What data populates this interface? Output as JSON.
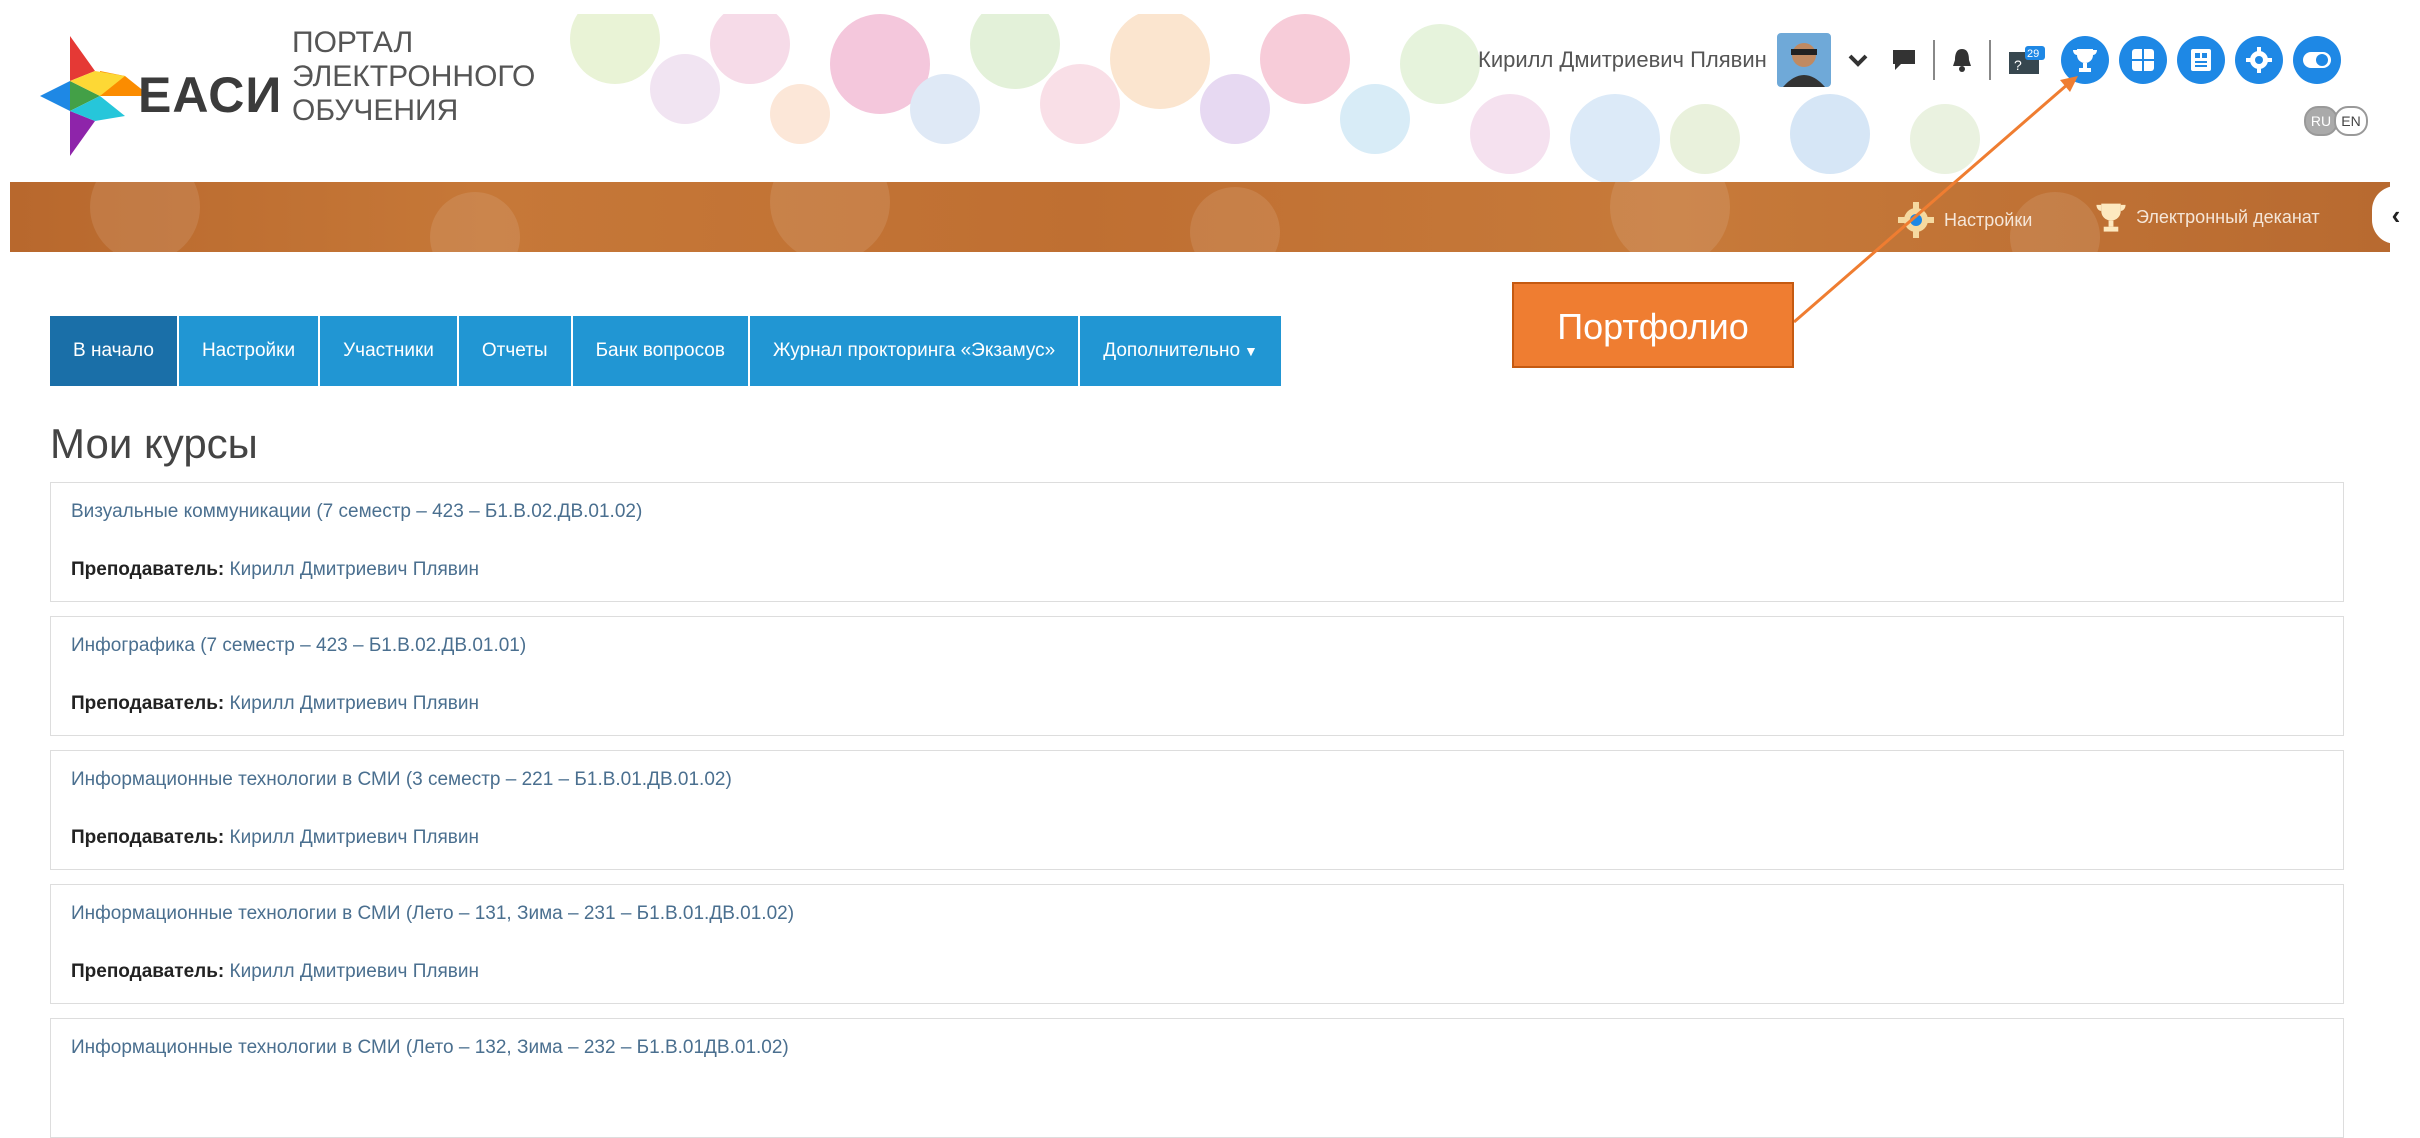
{
  "header": {
    "brand": "ЕАСИ",
    "portal_title": [
      "ПОРТАЛ",
      "ЭЛЕКТРОННОГО",
      "ОБУЧЕНИЯ"
    ],
    "user_name": "Кирилл Дмитриевич Плявин",
    "message_badge": "29",
    "languages": [
      "RU",
      "EN"
    ],
    "active_language": "RU",
    "round_icons": [
      "trophy-icon",
      "grid-icon",
      "report-icon",
      "gear-icon",
      "toggle-icon"
    ],
    "accent_color": "#1e88e5"
  },
  "band": {
    "settings_label": "Настройки",
    "deanery_label": "Электронный деканат",
    "color": "#c27436"
  },
  "nav": {
    "items": [
      "В начало",
      "Настройки",
      "Участники",
      "Отчеты",
      "Банк вопросов",
      "Журнал прокторинга «Экзамус»",
      "Дополнительно"
    ],
    "active_index": 0,
    "color": "#2196d3"
  },
  "annotation": {
    "label": "Портфолио",
    "color": "#ef7d31"
  },
  "main": {
    "title": "Мои курсы",
    "teacher_label": "Преподаватель:",
    "courses": [
      {
        "name": "Визуальные коммуникации (7 семестр – 423 – Б1.В.02.ДВ.01.02)",
        "teacher": "Кирилл Дмитриевич Плявин"
      },
      {
        "name": "Инфографика (7 семестр – 423 – Б1.В.02.ДВ.01.01)",
        "teacher": "Кирилл Дмитриевич Плявин"
      },
      {
        "name": "Информационные технологии в СМИ (3 семестр – 221 – Б1.В.01.ДВ.01.02)",
        "teacher": "Кирилл Дмитриевич Плявин"
      },
      {
        "name": "Информационные технологии в СМИ (Лето – 131, Зима – 231 – Б1.В.01.ДВ.01.02)",
        "teacher": "Кирилл Дмитриевич Плявин"
      },
      {
        "name": "Информационные технологии в СМИ (Лето – 132, Зима – 232 – Б1.В.01ДВ.01.02)",
        "teacher": ""
      }
    ]
  }
}
